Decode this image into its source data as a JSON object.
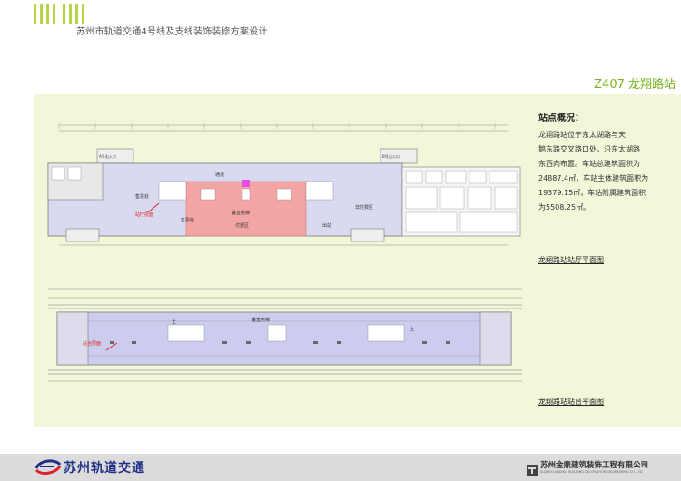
{
  "header": {
    "doc_title": "苏州市轨道交通4号线及支线装饰装修方案设计",
    "accent_color": "#b6d44a"
  },
  "station": {
    "title": "Z407 龙翔路站",
    "title_color": "#79b320"
  },
  "overview": {
    "heading": "站点概况：",
    "lines": [
      "龙翔路站位于东太湖路与天",
      "鹅东路交叉路口处，沿东太湖路",
      "东西向布置。车站总建筑面积为",
      "24887.4㎡，车站主体建筑面积为",
      "19379.15㎡，车站附属建筑面积",
      "为5508.25㎡。"
    ]
  },
  "plans": {
    "hall_caption": "龙翔路站站厅平面图",
    "platform_caption": "龙翔路站站台平面图",
    "hall_labels": {
      "marker": "站厅层面",
      "paid_zone": "付费区",
      "unpaid_zone_left": "售票处",
      "unpaid_zone_right": "非付费区",
      "elevator": "垂直电梯",
      "passage": "通道",
      "stairs": "出站",
      "ticket": "售票处",
      "entry_left": "A号出入口",
      "entry_right": "B号出入口"
    },
    "platform_labels": {
      "marker": "站台层面",
      "elevator": "垂直电梯",
      "up_left": "上",
      "up_right": "上"
    },
    "colors": {
      "paid": "#f3a4a4",
      "unpaid": "#ccccee",
      "highlight": "#e64de6",
      "wall": "#8a8a8a",
      "marker": "#e02020"
    }
  },
  "footer": {
    "brand": "苏州轨道交通",
    "company": "苏州金鼎建筑装饰工程有限公司",
    "company_en": "SUZHOU JINDING BUILDING DECORATION ENGINEERING CO.,LTD"
  }
}
